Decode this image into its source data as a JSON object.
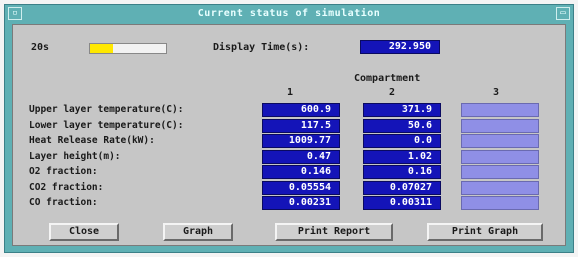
{
  "window": {
    "title": "Current status of simulation",
    "close_glyph": "▫",
    "max_glyph": "▭"
  },
  "status": {
    "label": "20s",
    "progress_fraction": 0.3,
    "display_time_label": "Display Time(s):",
    "display_time_value": "292.950"
  },
  "compartment_header": "Compartment",
  "compartments": [
    "1",
    "2",
    "3"
  ],
  "rows": [
    {
      "label": "Upper layer temperature(C):",
      "values": [
        "600.9",
        "371.9",
        ""
      ]
    },
    {
      "label": "Lower layer temperature(C):",
      "values": [
        "117.5",
        "50.6",
        ""
      ]
    },
    {
      "label": "Heat Release Rate(kW):",
      "values": [
        "1009.77",
        "0.0",
        ""
      ]
    },
    {
      "label": "Layer height(m):",
      "values": [
        "0.47",
        "1.02",
        ""
      ]
    },
    {
      "label": "O2  fraction:",
      "values": [
        "0.146",
        "0.16",
        ""
      ]
    },
    {
      "label": "CO2 fraction:",
      "values": [
        "0.05554",
        "0.07027",
        ""
      ]
    },
    {
      "label": "CO  fraction:",
      "values": [
        "0.00231",
        "0.00311",
        ""
      ]
    }
  ],
  "buttons": {
    "close": "Close",
    "graph": "Graph",
    "print_report": "Print Report",
    "print_graph": "Print Graph"
  },
  "colors": {
    "frame": "#5fb0b4",
    "field": "#1414b8",
    "field_empty": "#8f8fe6",
    "progress": "#ffe800"
  }
}
